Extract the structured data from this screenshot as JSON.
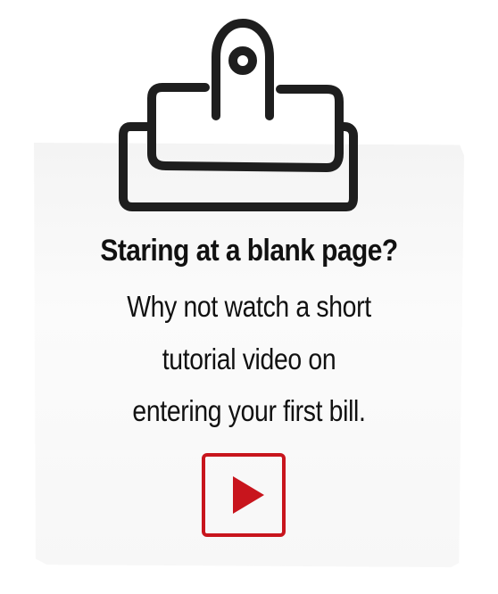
{
  "card": {
    "headline": "Staring at a blank page?",
    "body_lines": [
      "Why not watch a short",
      "tutorial video on",
      "entering your first bill."
    ]
  },
  "icons": {
    "clip": "clipboard-clip-icon",
    "play": "play-icon"
  },
  "colors": {
    "accent": "#c8151d",
    "text": "#111111",
    "paper": "#f5f5f5",
    "clip_stroke": "#1e1e1e"
  }
}
